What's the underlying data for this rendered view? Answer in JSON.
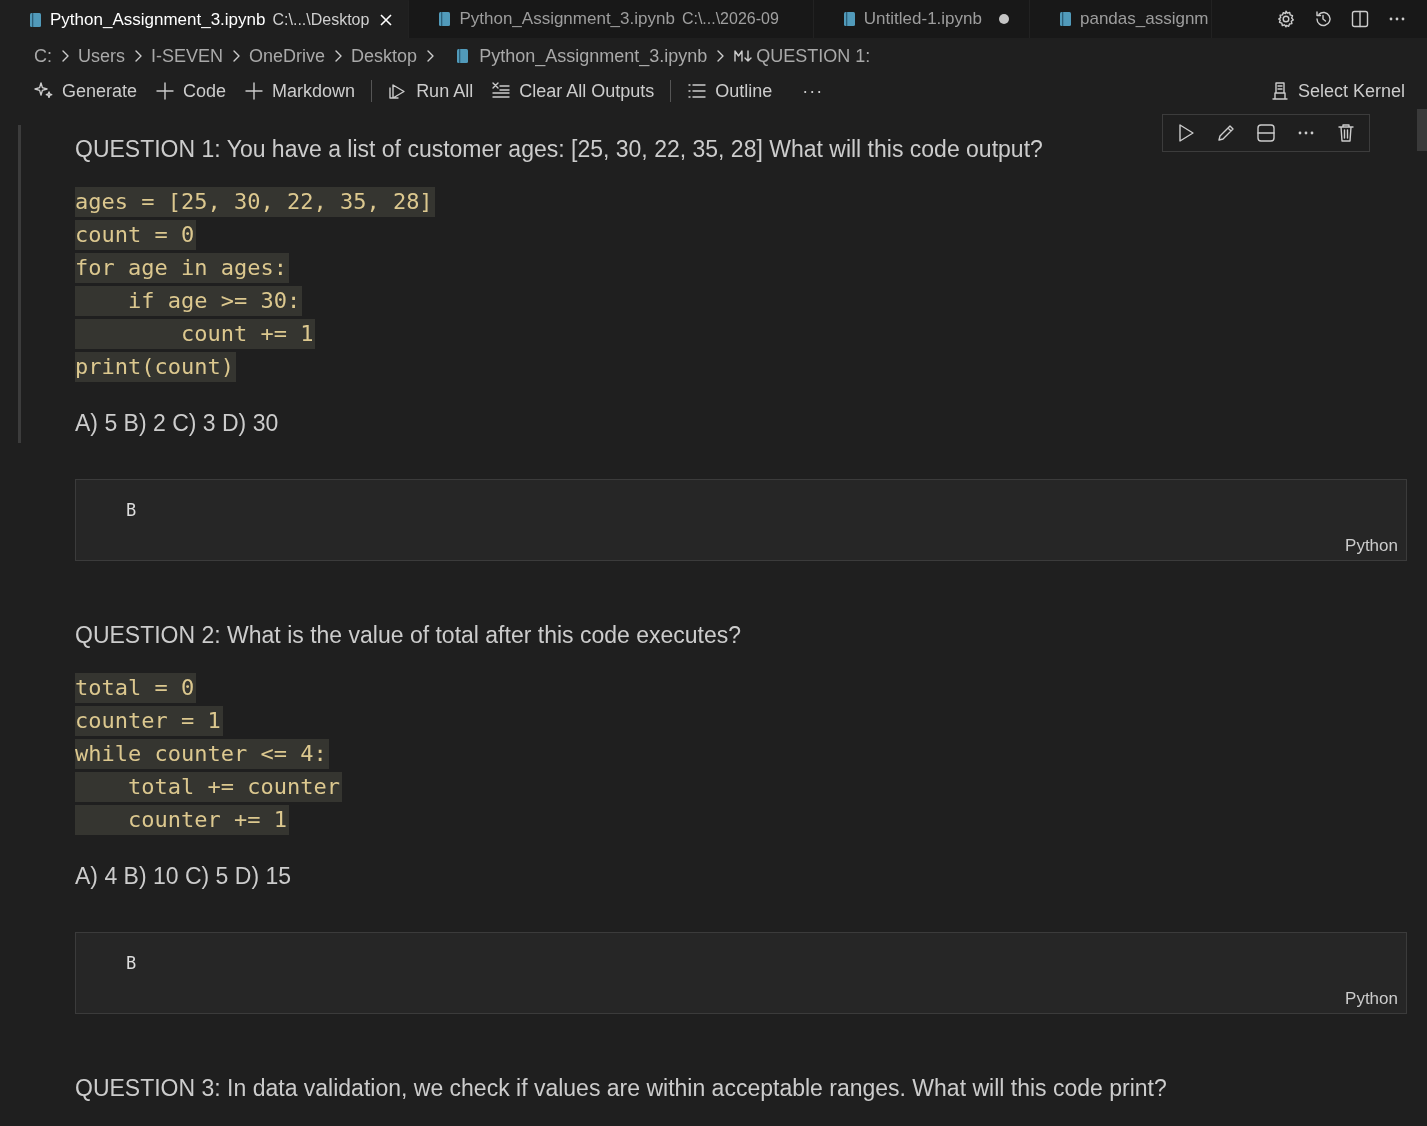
{
  "tabs": [
    {
      "label": "Python_Assignment_3.ipynb",
      "path": "C:\\...\\Desktop",
      "selected": true,
      "dirty": false
    },
    {
      "label": "Python_Assignment_3.ipynb",
      "path": "C:\\...\\2026-09",
      "selected": false,
      "dirty": false
    },
    {
      "label": "Untitled-1.ipynb",
      "selected": false,
      "dirty": true
    },
    {
      "label": "pandas_assignm",
      "selected": false,
      "dirty": false
    }
  ],
  "breadcrumb": [
    {
      "label": "C:",
      "kind": "folder"
    },
    {
      "label": "Users",
      "kind": "folder"
    },
    {
      "label": "I-SEVEN",
      "kind": "folder"
    },
    {
      "label": "OneDrive",
      "kind": "folder"
    },
    {
      "label": "Desktop",
      "kind": "folder"
    },
    {
      "label": "Python_Assignment_3.ipynb",
      "kind": "notebook"
    },
    {
      "label": "QUESTION 1:",
      "kind": "markdown"
    }
  ],
  "toolbar": [
    {
      "label": "Generate",
      "kind": "sparkle"
    },
    {
      "label": "Code",
      "kind": "plus"
    },
    {
      "label": "Markdown",
      "kind": "plus"
    },
    {
      "kind": "separator"
    },
    {
      "label": "Run All",
      "kind": "run"
    },
    {
      "label": "Clear All Outputs",
      "kind": "clear"
    },
    {
      "kind": "separator"
    },
    {
      "label": "Outline",
      "kind": "outline"
    },
    {
      "label": "···",
      "kind": "more"
    }
  ],
  "kernel": {
    "label": "Select Kernel"
  },
  "cells": [
    {
      "kind": "markdown",
      "focused": true,
      "question": "QUESTION 1: You have a list of customer ages: [25, 30, 22, 35, 28] What will this code output?",
      "code": [
        "ages = [25, 30, 22, 35, 28]",
        "count = 0",
        "for age in ages:",
        "    if age >= 30:",
        "        count += 1",
        "print(count)"
      ],
      "options": "A) 5 B) 2 C) 3 D) 30"
    },
    {
      "kind": "code",
      "source": "B",
      "language": "Python"
    },
    {
      "kind": "markdown",
      "focused": false,
      "question": "QUESTION 2: What is the value of total after this code executes?",
      "code": [
        "total = 0",
        "counter = 1",
        "while counter <= 4:",
        "    total += counter",
        "    counter += 1"
      ],
      "options": "A) 4 B) 10 C) 5 D) 15"
    },
    {
      "kind": "code",
      "source": "B",
      "language": "Python"
    },
    {
      "kind": "markdown",
      "focused": false,
      "question": "QUESTION 3: In data validation, we check if values are within acceptable ranges. What will this code print?"
    }
  ]
}
